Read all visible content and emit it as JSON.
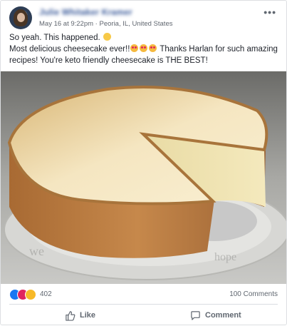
{
  "post": {
    "author_name": "Julie Whitaker Kramer",
    "timestamp": "May 16 at 9:22pm",
    "location": "Peoria, IL, United States",
    "separator": " · ",
    "line1": "So yeah. This happened.",
    "line2_start": "Most delicious cheesecake ever!!",
    "line2_end": "Thanks Harlan for such amazing",
    "line3": "recipes! You're keto friendly cheesecake is THE BEST!",
    "more_icon": "three-dots-icon",
    "photo_subject": "cheesecake-photo"
  },
  "engagement": {
    "reaction_count": "402",
    "comments_count": "100 Comments",
    "reaction_icons": [
      "like",
      "love",
      "wow"
    ]
  },
  "actions": {
    "like_label": "Like",
    "comment_label": "Comment"
  },
  "colors": {
    "link_blue": "#385898",
    "meta_gray": "#616770",
    "like_blue": "#1877f2",
    "love_red": "#e0245e",
    "wow_yellow": "#f7b928"
  }
}
